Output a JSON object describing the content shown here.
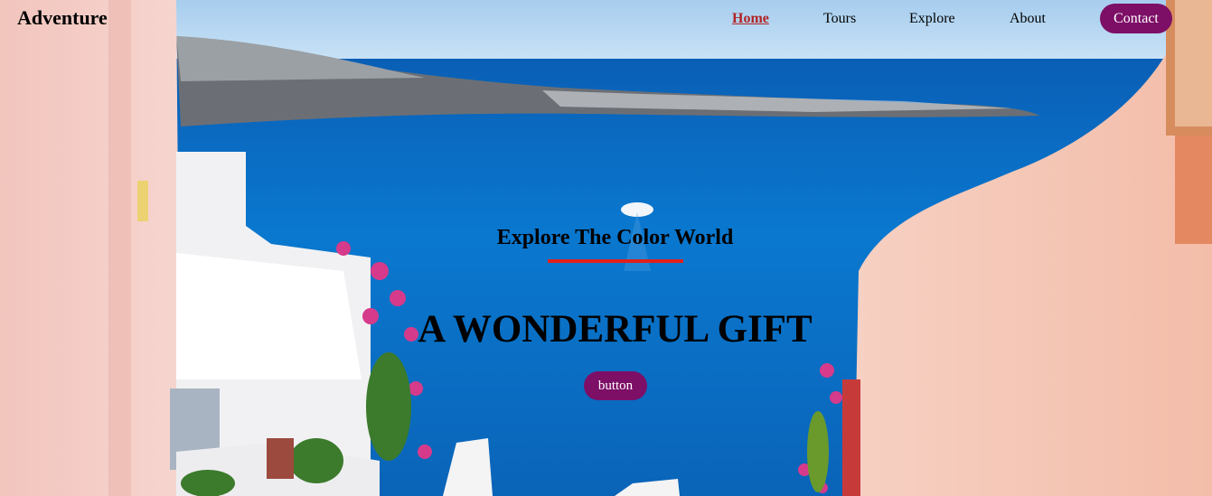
{
  "brand": {
    "name": "Adventure"
  },
  "nav": {
    "links": [
      {
        "label": "Home",
        "active": true
      },
      {
        "label": "Tours",
        "active": false
      },
      {
        "label": "Explore",
        "active": false
      },
      {
        "label": "About",
        "active": false
      }
    ],
    "contact_label": "Contact"
  },
  "hero": {
    "subtitle": "Explore The Color World",
    "headline": "A WONDERFUL GIFT",
    "button_label": "button"
  },
  "colors": {
    "accent": "#7d0f67",
    "active_link": "#b02424",
    "underline": "#e0201c",
    "sea": "#0a74c4",
    "sky": "#a9d4f2"
  }
}
